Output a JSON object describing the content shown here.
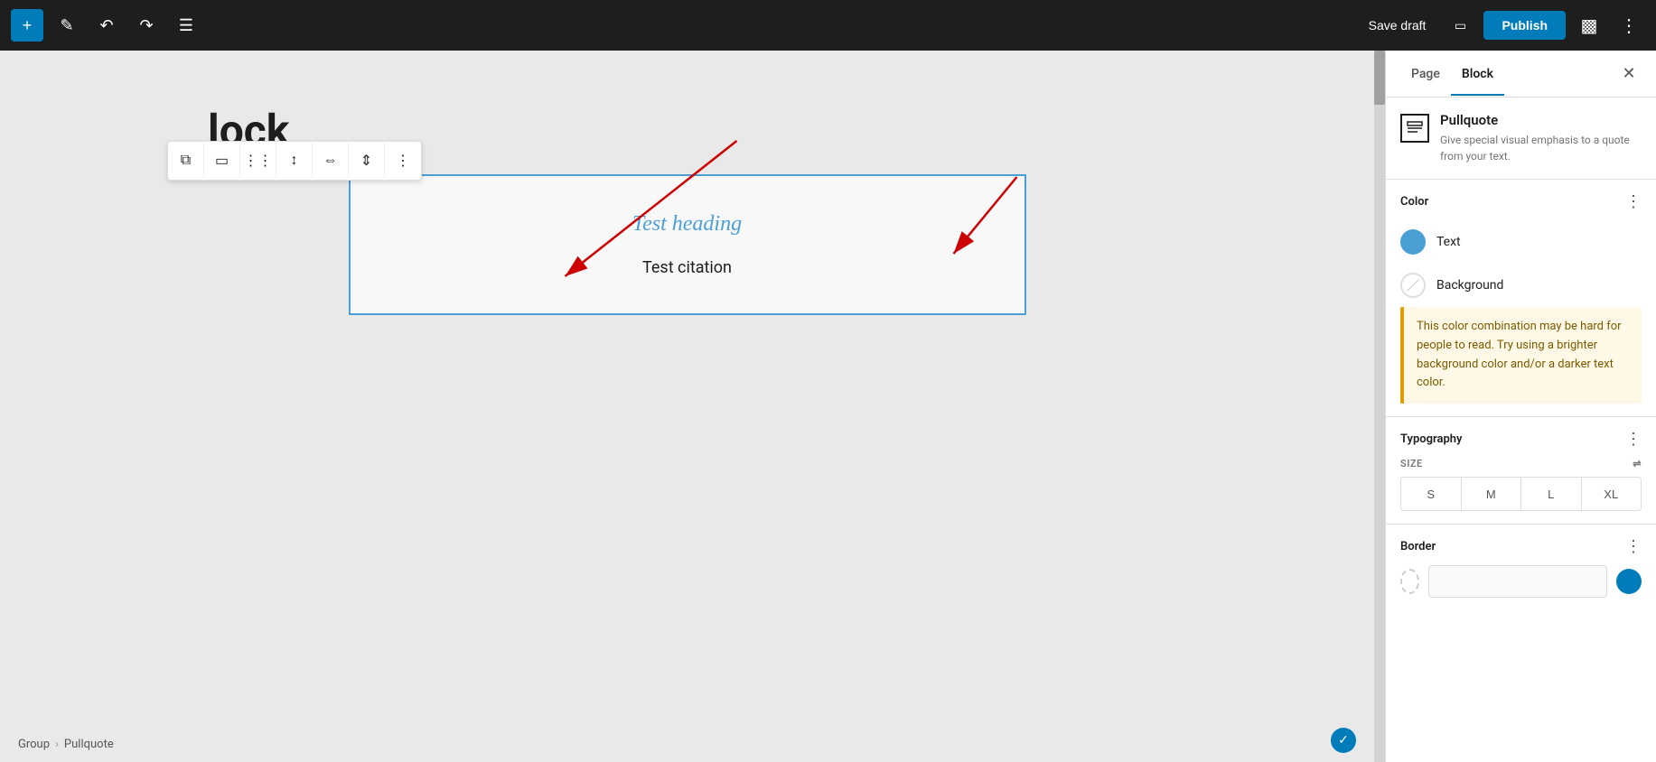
{
  "toolbar": {
    "add_icon": "+",
    "pen_icon": "✏",
    "undo_icon": "↩",
    "redo_icon": "↪",
    "menu_icon": "☰",
    "save_draft_label": "Save draft",
    "publish_label": "Publish",
    "settings_icon": "▣",
    "more_icon": "⋮"
  },
  "block_toolbar": {
    "copy_icon": "⧉",
    "layout_icon": "▭",
    "drag_icon": "⠿",
    "arrows_icon": "⇅",
    "align_left_icon": "≡",
    "align_center_icon": "≡",
    "more_icon": "⋮"
  },
  "editor": {
    "heading_text": "lock",
    "pullquote_heading": "Test heading",
    "pullquote_citation": "Test citation"
  },
  "breadcrumb": {
    "items": [
      "Group",
      "Pullquote"
    ],
    "separator": "›"
  },
  "sidebar": {
    "tabs": [
      {
        "id": "page",
        "label": "Page",
        "active": false
      },
      {
        "id": "block",
        "label": "Block",
        "active": true
      }
    ],
    "close_icon": "✕",
    "block_info": {
      "name": "Pullquote",
      "description": "Give special visual emphasis to a quote from your text."
    },
    "color_section": {
      "title": "Color",
      "more_icon": "⋮",
      "options": [
        {
          "id": "text",
          "label": "Text",
          "swatch": "teal"
        },
        {
          "id": "background",
          "label": "Background",
          "swatch": "empty"
        }
      ]
    },
    "warning": {
      "text": "This color combination may be hard for people to read. Try using a brighter background color and/or a darker text color."
    },
    "typography_section": {
      "title": "Typography",
      "more_icon": "⋮",
      "size_label": "SIZE",
      "size_options": [
        "S",
        "M",
        "L",
        "XL"
      ],
      "filter_icon": "⇌"
    },
    "border_section": {
      "title": "Border",
      "more_icon": "⋮"
    }
  }
}
